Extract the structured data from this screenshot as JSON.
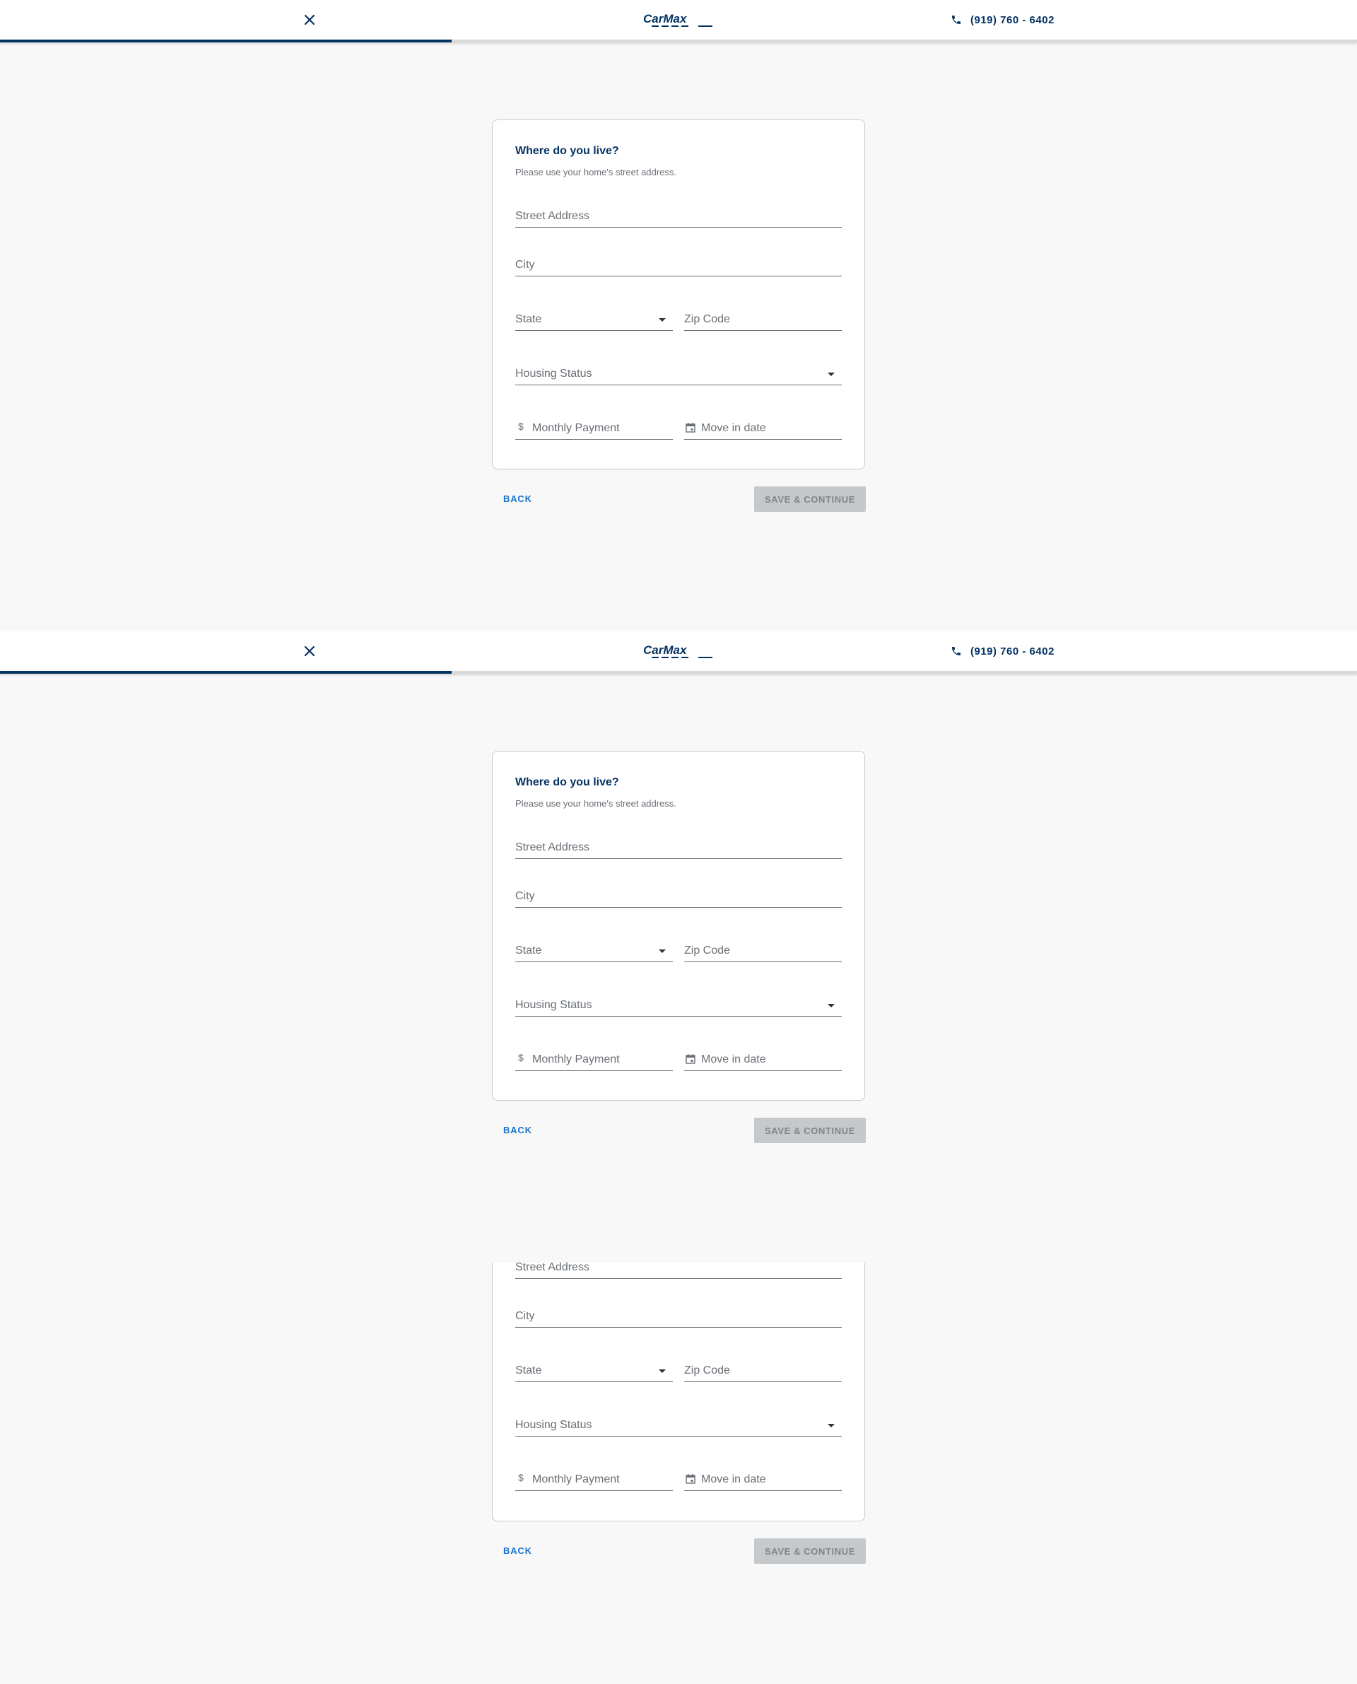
{
  "header": {
    "logo_text": "CARMAX",
    "phone": "(919) 760 - 6402"
  },
  "form": {
    "title": "Where do you live?",
    "subtitle": "Please use your home's street address.",
    "street_placeholder": "Street Address",
    "city_placeholder": "City",
    "state_placeholder": "State",
    "zip_placeholder": "Zip Code",
    "housing_placeholder": "Housing Status",
    "payment_prefix": "$",
    "payment_placeholder": "Monthly Payment",
    "move_in_placeholder": "Move in date"
  },
  "actions": {
    "back_label": "BACK",
    "save_label": "SAVE & CONTINUE"
  },
  "progress": {
    "fraction": 0.333
  },
  "colors": {
    "brand": "#053361",
    "link": "#1773cf",
    "disabled_button": "#c6c9cc",
    "background": "#f8f8f8"
  }
}
